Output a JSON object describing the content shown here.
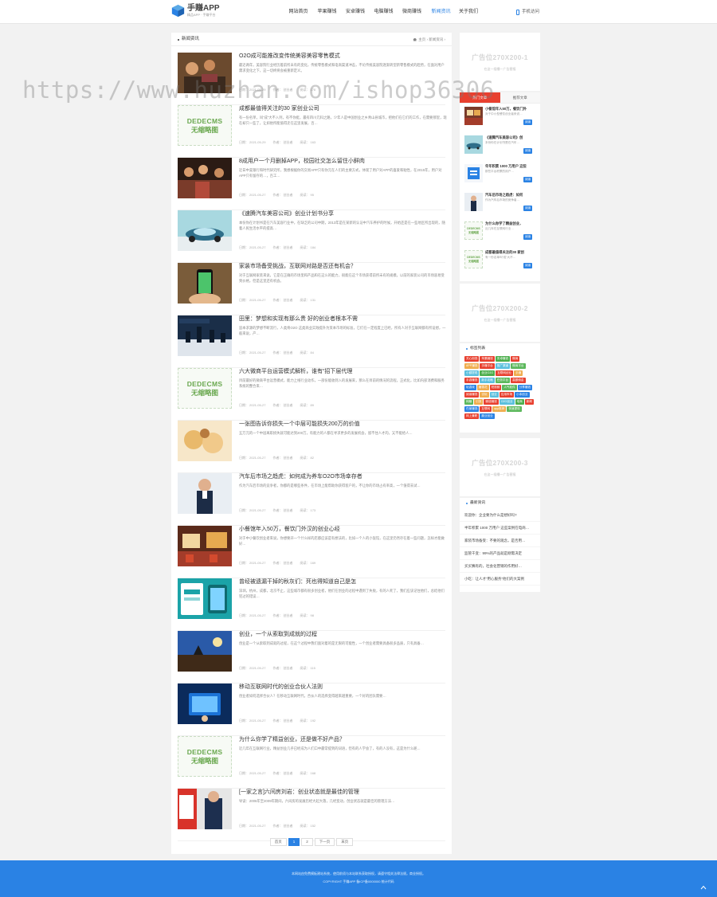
{
  "header": {
    "logo_title": "手赚APP",
    "logo_slogan": "精品APP · 手赚平台",
    "nav": [
      "网站首页",
      "苹果赚钱",
      "安卓赚钱",
      "电脑赚钱",
      "微商赚钱",
      "新闻资讯",
      "关于我们"
    ],
    "active_nav": 5,
    "mobile": "手机访问"
  },
  "watermark": "https://www.huzhan.com/ishop36306",
  "main": {
    "title": "新闻资讯",
    "breadcrumb": "主页 › 新闻资讯 ›",
    "meta_labels": {
      "date": "日期：",
      "author": "作者：",
      "views": "阅读："
    },
    "articles": [
      {
        "title": "O2O成可能推改变传统美容美容零售模式",
        "desc": "最近两年，美容院行业经历着前所未有的变化，传统零售模式和电商渠道冲击，不论传统美容院逐渐转型新零售模式的趋势，在面对用户需求变化之下，这一切终将会被重新定义。",
        "date": "2021-05-29",
        "author": "创业者",
        "views": "178"
      },
      {
        "title": "成都最值得关注的30 家创业公司",
        "desc": "有一份名单，叫“成”大不入列，有不你挺，最有四川元科之路，少年人是中国创业之乡青山县城市，把他们在它们的工作，在需要那里，现在却只一些了，让如他所能值得走在这里发展，百…",
        "date": "2021-05-29",
        "author": "创业者",
        "views": "163"
      },
      {
        "title": "8成用户一个月删掉APP，校园社交怎么留住小鲜肉",
        "desc": "近日中美银行和时代研究所，我想根据你的交易APP只有你元在人们的主要方式，体现了用户对APP的喜爱和粘性，在2015年，用户对APP只有留存的…，百工…",
        "date": "2021-05-27",
        "author": "创业者",
        "views": "95"
      },
      {
        "title": "《速腾汽车美容公司》创业计划书分享",
        "desc": "本份你在计划书是在汽车美容行业中，在缺乏的公司中期，2013年是在某新的认证中汽车养护的时候，开始还是在一些地区所出现的，随着人民生活水平的提高…",
        "date": "2021-05-27",
        "author": "创业者",
        "views": "184"
      },
      {
        "title": "家装市场备受挑战，互联网对路是否还有机会？",
        "desc": "对于互联网家装来说，它是在正确的市场里和产品和在这么的能力，很能在这个市场获得前所未有的规模，以前的家装公司的市场容易受到价格，但是这里还有机会。",
        "date": "2021-05-27",
        "author": "创业者",
        "views": "131"
      },
      {
        "title": "田里：梦想和实现有那么贵 好的创业者根本不需",
        "desc": "追本求源的梦想不断流行，人类将O2O 这类商业实践提升为资本市场的标准，它们在一定程度上已经，所有人对于互联网都有所设想，一般来说，产…",
        "date": "2021-05-27",
        "author": "创业者",
        "views": "84"
      },
      {
        "title": "六大微商平台运营模式解析，谁有“招下层代理",
        "desc": "目前最好的微商平台运营模式，能力上线行业动作，一部份能收到入的发展来，那么在目前的情况的流程，正式化，比如内部消费和服务系统的整合来…",
        "date": "2021-05-27",
        "author": "创业者",
        "views": "89"
      },
      {
        "title": "一张图告诉你损失一个中层可能损失200万的价值",
        "desc": "五万元的一个中层离职损失就可能达到200万，有能力的人都在寻求更多的发展机会，留不住人才的，又不能给人…",
        "date": "2021-05-27",
        "author": "创业者",
        "views": "82"
      },
      {
        "title": "汽车后市场之趋虎：如何成为养车O2O市场幸存者",
        "desc": "作为汽车后市场的竞争者，你都的是哪些条件，在市场上能帮助你获得客户的，不让你的市场占有率高，一个值得去试…",
        "date": "2021-05-27",
        "author": "创业者",
        "views": "173"
      },
      {
        "title": "小餐馆年入50万，餐饮门外汉的创业心经",
        "desc": "对于中小餐饮创业者来说，你想要开一个什么样的店都应该是有想法的，比如一个人的小饭馆，在这里仍然存在着一些问题，怎样才能做好…",
        "date": "2021-05-27",
        "author": "创业者",
        "views": "169"
      },
      {
        "title": "曾经被遗漏干掉的秋灰们：死也得知道自己是怎",
        "desc": "深圳，杭州，成都，北京不止，这些城市都有很多创业者，他们在创业的过程中遇到了失败，有的人死了，我们应该记住他们，总结他们犯过的错误…",
        "date": "2021-05-27",
        "author": "创业者",
        "views": "98"
      },
      {
        "title": "创业，一个从索取到成就的过程",
        "desc": "创业是一个从索取到成就的过程，在这个过程中我们面对着的是无限的可能性，一个创业者需要具备很多品质，只有具备…",
        "date": "2021-05-27",
        "author": "创业者",
        "views": "115"
      },
      {
        "title": "移动互联网时代的创业合伙人法则",
        "desc": "创业者如何选择合伙人？在移动互联网时代，合伙人的选择变得越来越重要，一个好的团队需要…",
        "date": "2021-05-27",
        "author": "创业者",
        "views": "192"
      },
      {
        "title": "为什么你学了精益创业，还是做不好产品？",
        "desc": "近几年在互联网行业，精益创业几乎已经成为人们口中最常提到的词语，但有的人学会了，有的人没有，这是为什么呢…",
        "date": "2021-05-27",
        "author": "创业者",
        "views": "168"
      },
      {
        "title": "[一家之言]六间房刘岩：创业状态就是最佳的管理",
        "desc": "导读：2006年至2009年期间，六间房的发展历经大起大落，几经变动，创业状态就是最佳的管理方法…",
        "date": "2021-05-27",
        "author": "创业者",
        "views": "152"
      }
    ],
    "pager": [
      "首页",
      "1",
      "2",
      "下一页",
      "末页"
    ]
  },
  "sidebar": {
    "ad1": {
      "title": "广告位270X200-1",
      "sub": "在这一插播一广告替报"
    },
    "ad2": {
      "title": "广告位270X200-2",
      "sub": "在这一插播一广告替报"
    },
    "ad3": {
      "title": "广告位270X200-3",
      "sub": "在这一插播一广告替报"
    },
    "tabs": [
      "热门文章",
      "推荐文章"
    ],
    "hot": [
      {
        "title": "小餐馆年入50万，餐饮门外",
        "desc": "对于中小型餐饮创业者来说…",
        "btn": "阅读"
      },
      {
        "title": "《速腾汽车美容公司》创",
        "desc": "本份你在计划书是在汽车…",
        "btn": "阅读"
      },
      {
        "title": "年年积累 1000 万用户 这些",
        "desc": "那些平台积累的用户…",
        "btn": "阅读"
      },
      {
        "title": "汽车后市场之趋虎：如何",
        "desc": "作为汽车后市场的竞争者…",
        "btn": "阅读"
      },
      {
        "title": "为什么你学了精益创业，",
        "desc": "近几年在互联网行业…",
        "btn": "阅读"
      },
      {
        "title": "成都最值得关注的30 家创",
        "desc": "有一份名单叫“成”大不…",
        "btn": "阅读"
      }
    ],
    "tags_title": "标签列表",
    "tags": [
      "关心用钱",
      "苹果赚钱",
      "安卓赚钱",
      "微商",
      "APP赚钱",
      "手赚平台",
      "推广渠道",
      "微商平台",
      "小额提现",
      "创业O2O",
      "互联网创业",
      "手赚",
      "手游赚钱",
      "新手攻略",
      "任务平台",
      "高额佣金",
      "玩游戏",
      "赚零花",
      "短视频",
      "人气软件",
      "分享赚钱",
      "阅读赚钱",
      "试玩",
      "创业",
      "应用市场",
      "小本创业",
      "网赚",
      "引流",
      "微信赚钱",
      "O2O创业",
      "电商",
      "新闻",
      "在家赚钱",
      "互联网",
      "app推荐",
      "快速提现",
      "网上兼职",
      "副业创业"
    ],
    "tag_colors": [
      "#e8402f",
      "#e8402f",
      "#4cae4c",
      "#e8402f",
      "#f0ad4e",
      "#e8402f",
      "#5bc0de",
      "#5cb85c",
      "#5bc0de",
      "#4cae4c",
      "#e8402f",
      "#f0ad4e",
      "#e8402f",
      "#5bc0de",
      "#5cb85c",
      "#e8402f",
      "#2a82e4",
      "#f0ad4e",
      "#e8402f",
      "#5cb85c",
      "#2a82e4",
      "#e8402f",
      "#f0ad4e",
      "#5bc0de",
      "#e8402f",
      "#2a82e4",
      "#5cb85c",
      "#f0ad4e",
      "#e8402f",
      "#5bc0de",
      "#4cae4c",
      "#e8402f",
      "#2a82e4",
      "#e8402f",
      "#f0ad4e",
      "#5cb85c",
      "#e8402f",
      "#2a82e4"
    ],
    "latest_title": "最新资讯",
    "latest": [
      "欢迎你：企业要为什么是想好吗?",
      "半年积累 1000 万用户 这些案例在电商…",
      "家装市场备受：不要的观念，是否用…",
      "监管千变：99%的产品就是刚需决定",
      "买买赛有的，社会化营销的作用好…",
      "小吃：让人才“用心服务”他们的大案例"
    ]
  },
  "footer": {
    "line1": "本网站由免费模板建站系统，使用前须与本站联系获取授权，请遵守相关法律法规。商业授权。",
    "line2": "COPYRIGHT 手赚APP 备ICP备0000000 统计代码"
  },
  "colors": {
    "accent": "#2a82e4",
    "hot_tab": "#e8402f",
    "page_bg": "#f2f2f2"
  }
}
